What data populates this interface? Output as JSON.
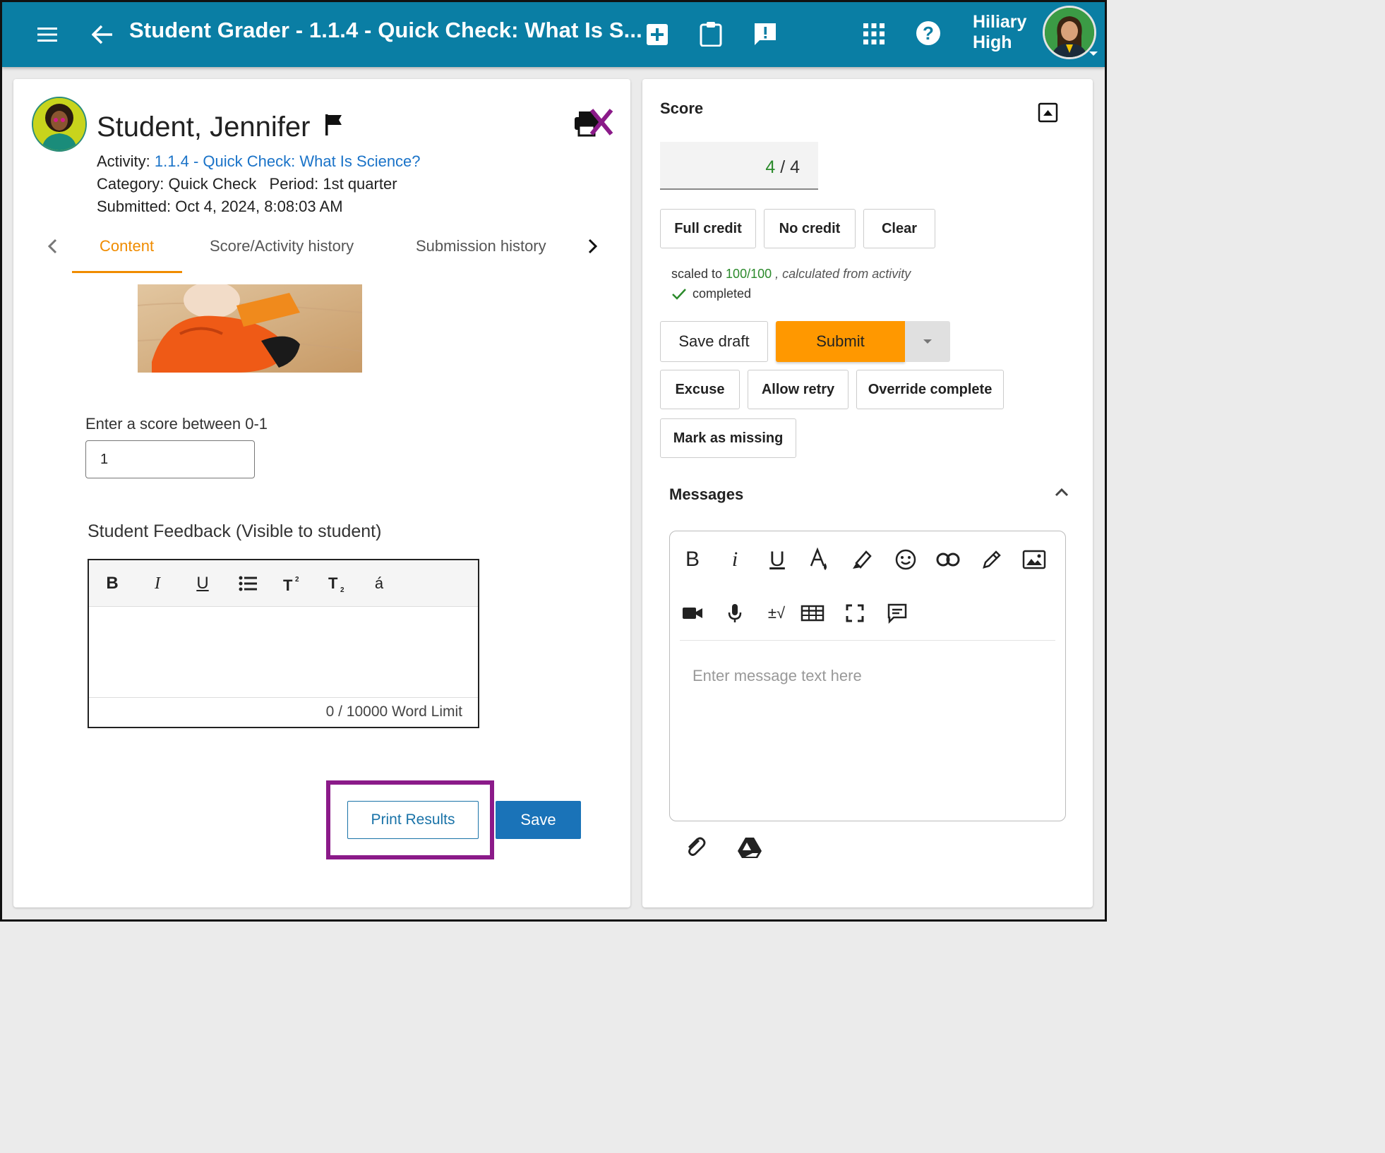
{
  "header": {
    "title": "Student Grader - 1.1.4 - Quick Check: What Is S...",
    "user_name_line1": "Hiliary",
    "user_name_line2": "High",
    "icons": [
      "menu-icon",
      "back-arrow-icon",
      "add-box-icon",
      "clipboard-icon",
      "feedback-icon",
      "apps-grid-icon",
      "help-icon",
      "avatar"
    ]
  },
  "student": {
    "name": "Student, Jennifer",
    "activity_label": "Activity:",
    "activity_link": "1.1.4 - Quick Check: What Is Science?",
    "category_line": "Category: Quick Check   Period: 1st quarter",
    "submitted_line": "Submitted: Oct 4, 2024, 8:08:03 AM"
  },
  "tabs": [
    {
      "label": "Content",
      "active": true
    },
    {
      "label": "Score/Activity history",
      "active": false
    },
    {
      "label": "Submission history",
      "active": false
    }
  ],
  "content": {
    "score_prompt": "Enter a score between 0-1",
    "score_value": "1",
    "feedback_label": "Student Feedback (Visible to student)",
    "word_limit": "0  / 10000 Word Limit",
    "toolbar": {
      "bold": "B",
      "italic": "I",
      "underline": "U",
      "accent": "á"
    },
    "print_results": "Print Results",
    "save": "Save"
  },
  "score_panel": {
    "title": "Score",
    "earned": "4",
    "separator": " / ",
    "possible": "4",
    "full_credit": "Full credit",
    "no_credit": "No credit",
    "clear": "Clear",
    "scaled_prefix": "scaled to ",
    "scaled_value": "100/100",
    "scaled_suffix": ", calculated from activity",
    "completed": "completed",
    "save_draft": "Save draft",
    "submit": "Submit",
    "excuse": "Excuse",
    "allow_retry": "Allow retry",
    "override_complete": "Override complete",
    "mark_missing": "Mark as missing"
  },
  "messages": {
    "title": "Messages",
    "placeholder": "Enter message text here",
    "toolbar_bold": "B",
    "toolbar_italic": "i",
    "toolbar_underline": "U",
    "toolbar_math": "±√"
  },
  "colors": {
    "header": "#0a7ea4",
    "accent_orange": "#ff9800",
    "tab_active": "#f08c00",
    "link": "#1a73c8",
    "highlight": "#8b1a89",
    "save_blue": "#1a73b8"
  }
}
